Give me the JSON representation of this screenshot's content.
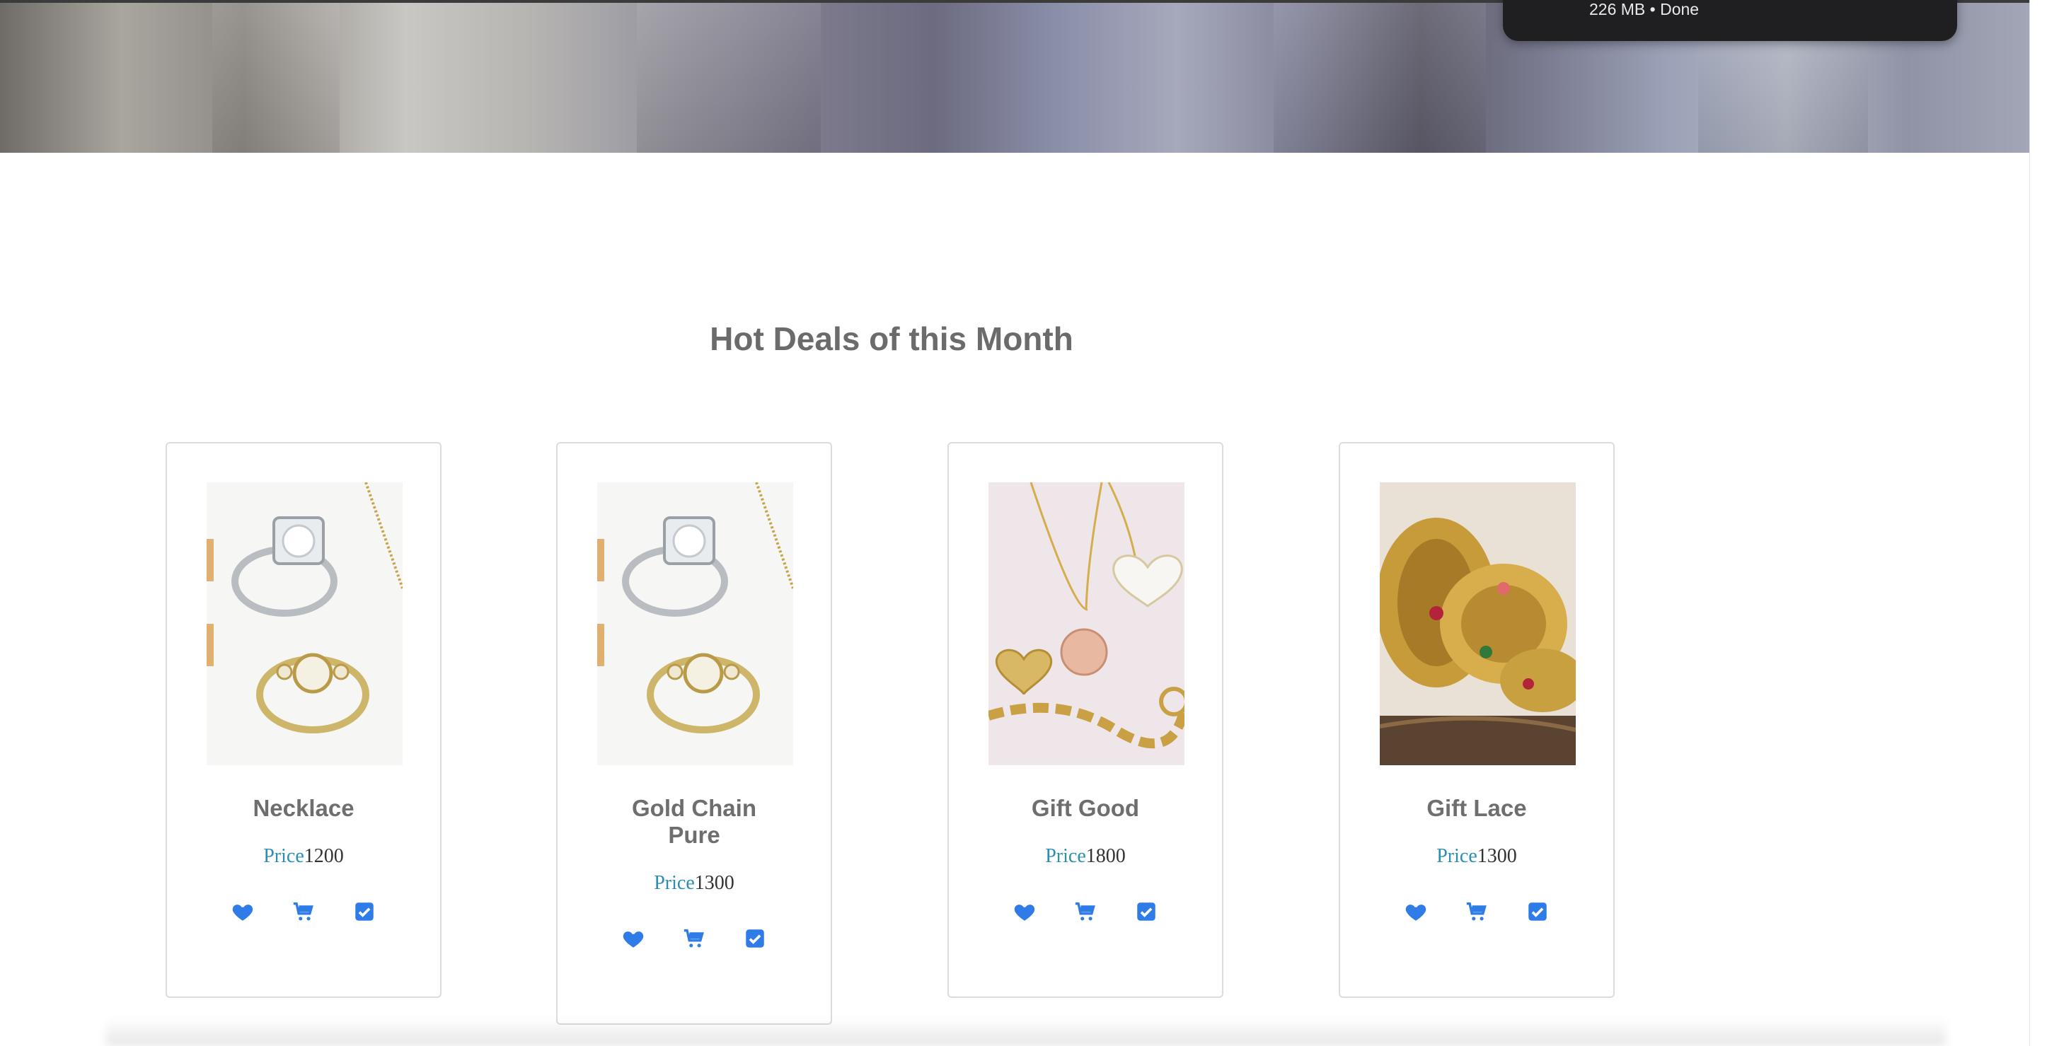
{
  "hero": {
    "accent": "#7d7b8c"
  },
  "download_toast": {
    "text": "226 MB • Done"
  },
  "section": {
    "title": "Hot Deals of this Month"
  },
  "products": [
    {
      "name": "Necklace",
      "price_label": "Price",
      "price": "1200",
      "image": "rings-icon"
    },
    {
      "name": "Gold Chain Pure",
      "price_label": "Price",
      "price": "1300",
      "image": "rings-icon"
    },
    {
      "name": "Gift Good",
      "price_label": "Price",
      "price": "1800",
      "image": "necklace-icon"
    },
    {
      "name": "Gift Lace",
      "price_label": "Price",
      "price": "1300",
      "image": "bangles-icon"
    }
  ],
  "icons": {
    "wishlist": "heart-icon",
    "cart": "cart-icon",
    "compare": "checkbox-icon",
    "color": "#2f7be8"
  }
}
